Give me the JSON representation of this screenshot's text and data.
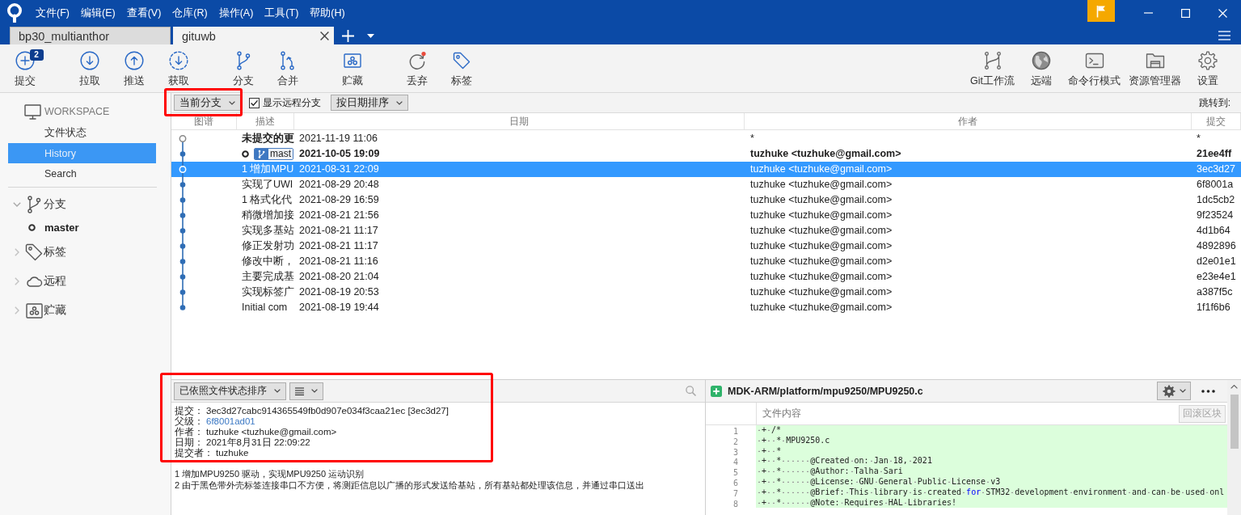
{
  "title_bar": {
    "menu": [
      "文件(F)",
      "编辑(E)",
      "查看(V)",
      "仓库(R)",
      "操作(A)",
      "工具(T)",
      "帮助(H)"
    ]
  },
  "tabs": [
    {
      "label": "bp30_multianthor",
      "selected": false
    },
    {
      "label": "gituwb",
      "selected": true
    }
  ],
  "toolbar": {
    "groups": [
      {
        "items": [
          {
            "kind": "commit",
            "label": "提交",
            "badge": "2"
          }
        ]
      },
      {
        "items": [
          {
            "kind": "pull",
            "label": "拉取"
          },
          {
            "kind": "push",
            "label": "推送"
          },
          {
            "kind": "fetch",
            "label": "获取"
          }
        ]
      },
      {
        "items": [
          {
            "kind": "branch",
            "label": "分支"
          },
          {
            "kind": "merge",
            "label": "合并"
          }
        ]
      },
      {
        "items": [
          {
            "kind": "stash",
            "label": "贮藏"
          }
        ]
      },
      {
        "items": [
          {
            "kind": "discard",
            "label": "丢弃"
          },
          {
            "kind": "tag",
            "label": "标签"
          }
        ]
      }
    ],
    "right": [
      {
        "kind": "git-flow",
        "label": "Git工作流"
      },
      {
        "kind": "remote",
        "label": "远端"
      },
      {
        "kind": "terminal",
        "label": "命令行模式"
      },
      {
        "kind": "explorer",
        "label": "资源管理器"
      },
      {
        "kind": "settings",
        "label": "设置"
      }
    ]
  },
  "sidebar": {
    "workspace": {
      "title": "WORKSPACE",
      "items": [
        {
          "label": "文件状态",
          "selected": false
        },
        {
          "label": "History",
          "selected": true
        },
        {
          "label": "Search",
          "selected": false
        }
      ]
    },
    "groups": [
      {
        "kind": "branches",
        "label": "分支",
        "expanded": true,
        "children": [
          {
            "label": "master",
            "current": true
          }
        ]
      },
      {
        "kind": "tags",
        "label": "标签",
        "expanded": false
      },
      {
        "kind": "remotes",
        "label": "远程",
        "expanded": false
      },
      {
        "kind": "stashes",
        "label": "贮藏",
        "expanded": false
      }
    ]
  },
  "history_toolbar": {
    "branch_filter": {
      "value": "当前分支",
      "highlighted": true
    },
    "show_remote_branches": {
      "label": "显示远程分支",
      "checked": true
    },
    "sort": {
      "value": "按日期排序"
    },
    "jump_to": "跳转到:"
  },
  "table": {
    "columns": [
      "图谱",
      "描述",
      "日期",
      "作者",
      "提交"
    ],
    "rows": [
      {
        "kind": "uncommitted",
        "selected": false,
        "bold": false,
        "head": false,
        "description": "未提交的更",
        "date": "2021-11-19 11:06",
        "author": "*",
        "commit": "*"
      },
      {
        "kind": "commit",
        "selected": false,
        "bold": true,
        "head": true,
        "branch": "mast",
        "date": "2021-10-05 19:09",
        "author": "tuzhuke <tuzhuke@gmail.com>",
        "commit": "21ee4ff"
      },
      {
        "kind": "commit",
        "selected": true,
        "bold": false,
        "head": false,
        "description": "1 增加MPU",
        "date": "2021-08-31 22:09",
        "author": "tuzhuke <tuzhuke@gmail.com>",
        "commit": "3ec3d27"
      },
      {
        "kind": "commit",
        "selected": false,
        "bold": false,
        "head": false,
        "description": "实现了UWI",
        "date": "2021-08-29 20:48",
        "author": "tuzhuke <tuzhuke@gmail.com>",
        "commit": "6f8001a"
      },
      {
        "kind": "commit",
        "selected": false,
        "bold": false,
        "head": false,
        "description": "1 格式化代",
        "date": "2021-08-29 16:59",
        "author": "tuzhuke <tuzhuke@gmail.com>",
        "commit": "1dc5cb2"
      },
      {
        "kind": "commit",
        "selected": false,
        "bold": false,
        "head": false,
        "description": "稍微增加接",
        "date": "2021-08-21 21:56",
        "author": "tuzhuke <tuzhuke@gmail.com>",
        "commit": "9f23524"
      },
      {
        "kind": "commit",
        "selected": false,
        "bold": false,
        "head": false,
        "description": "实现多基站",
        "date": "2021-08-21 11:17",
        "author": "tuzhuke <tuzhuke@gmail.com>",
        "commit": "4d1b64"
      },
      {
        "kind": "commit",
        "selected": false,
        "bold": false,
        "head": false,
        "description": "修正发射功",
        "date": "2021-08-21 11:17",
        "author": "tuzhuke <tuzhuke@gmail.com>",
        "commit": "4892896"
      },
      {
        "kind": "commit",
        "selected": false,
        "bold": false,
        "head": false,
        "description": "修改中断，",
        "date": "2021-08-21 11:16",
        "author": "tuzhuke <tuzhuke@gmail.com>",
        "commit": "d2e01e1"
      },
      {
        "kind": "commit",
        "selected": false,
        "bold": false,
        "head": false,
        "description": "主要完成基",
        "date": "2021-08-20 21:04",
        "author": "tuzhuke <tuzhuke@gmail.com>",
        "commit": "e23e4e1"
      },
      {
        "kind": "commit",
        "selected": false,
        "bold": false,
        "head": false,
        "description": "实现标签广",
        "date": "2021-08-19 20:53",
        "author": "tuzhuke <tuzhuke@gmail.com>",
        "commit": "a387f5c"
      },
      {
        "kind": "commit",
        "selected": false,
        "bold": false,
        "head": false,
        "description": "Initial com",
        "date": "2021-08-19 19:44",
        "author": "tuzhuke <tuzhuke@gmail.com>",
        "commit": "1f1f6b6"
      }
    ]
  },
  "file_list": {
    "sort": "已依照文件状态排序"
  },
  "commit_details": {
    "highlighted": true,
    "fields": [
      {
        "kind": "text",
        "label": "提交：",
        "value": "3ec3d27cabc914365549fb0d907e034f3caa21ec [3ec3d27]"
      },
      {
        "kind": "link",
        "label": "父级：",
        "value": "6f8001ad01"
      },
      {
        "kind": "text",
        "label": "作者：",
        "value": "tuzhuke <tuzhuke@gmail.com>"
      },
      {
        "kind": "text",
        "label": "日期：",
        "value": "2021年8月31日 22:09:22"
      },
      {
        "kind": "text",
        "label": "提交者：",
        "value": "tuzhuke"
      }
    ],
    "message": [
      "1 增加MPU9250 驱动，实现MPU9250 运动识别",
      "2 由于黑色带外壳标签连接串口不方便，将测距信息以广播的形式发送给基站，所有基站都处理该信息，并通过串口送出"
    ]
  },
  "diff": {
    "file": {
      "path": "MDK-ARM/platform/mpu9250/MPU9250.c",
      "kind": "added"
    },
    "hunk": {
      "title": "文件内容",
      "action": {
        "label": "回滚区块",
        "disabled": true
      }
    },
    "show_whitespace": true,
    "lines": [
      {
        "number": "1",
        "kind": "added",
        "tokens": [
          {
            "kind": "plain",
            "text": " + /*"
          }
        ]
      },
      {
        "number": "2",
        "kind": "added",
        "tokens": [
          {
            "kind": "plain",
            "text": " +  * MPU9250.c"
          }
        ]
      },
      {
        "number": "3",
        "kind": "added",
        "tokens": [
          {
            "kind": "plain",
            "text": " +  *"
          }
        ]
      },
      {
        "number": "4",
        "kind": "added",
        "tokens": [
          {
            "kind": "plain",
            "text": " +  *      @Created on: Jan 18, 2021"
          }
        ]
      },
      {
        "number": "5",
        "kind": "added",
        "tokens": [
          {
            "kind": "plain",
            "text": " +  *      @Author: Talha Sari"
          }
        ]
      },
      {
        "number": "6",
        "kind": "added",
        "tokens": [
          {
            "kind": "plain",
            "text": " +  *      @License: GNU General Public License v3"
          }
        ]
      },
      {
        "number": "7",
        "kind": "added",
        "tokens": [
          {
            "kind": "plain",
            "text": " +  *      @Brief: This library is created "
          },
          {
            "kind": "keyword",
            "text": "for"
          },
          {
            "kind": "plain",
            "text": " STM32 development environment and can be used onl"
          }
        ]
      },
      {
        "number": "8",
        "kind": "added",
        "tokens": [
          {
            "kind": "plain",
            "text": " +  *      @Note: Requires HAL Libraries!"
          }
        ]
      }
    ]
  }
}
